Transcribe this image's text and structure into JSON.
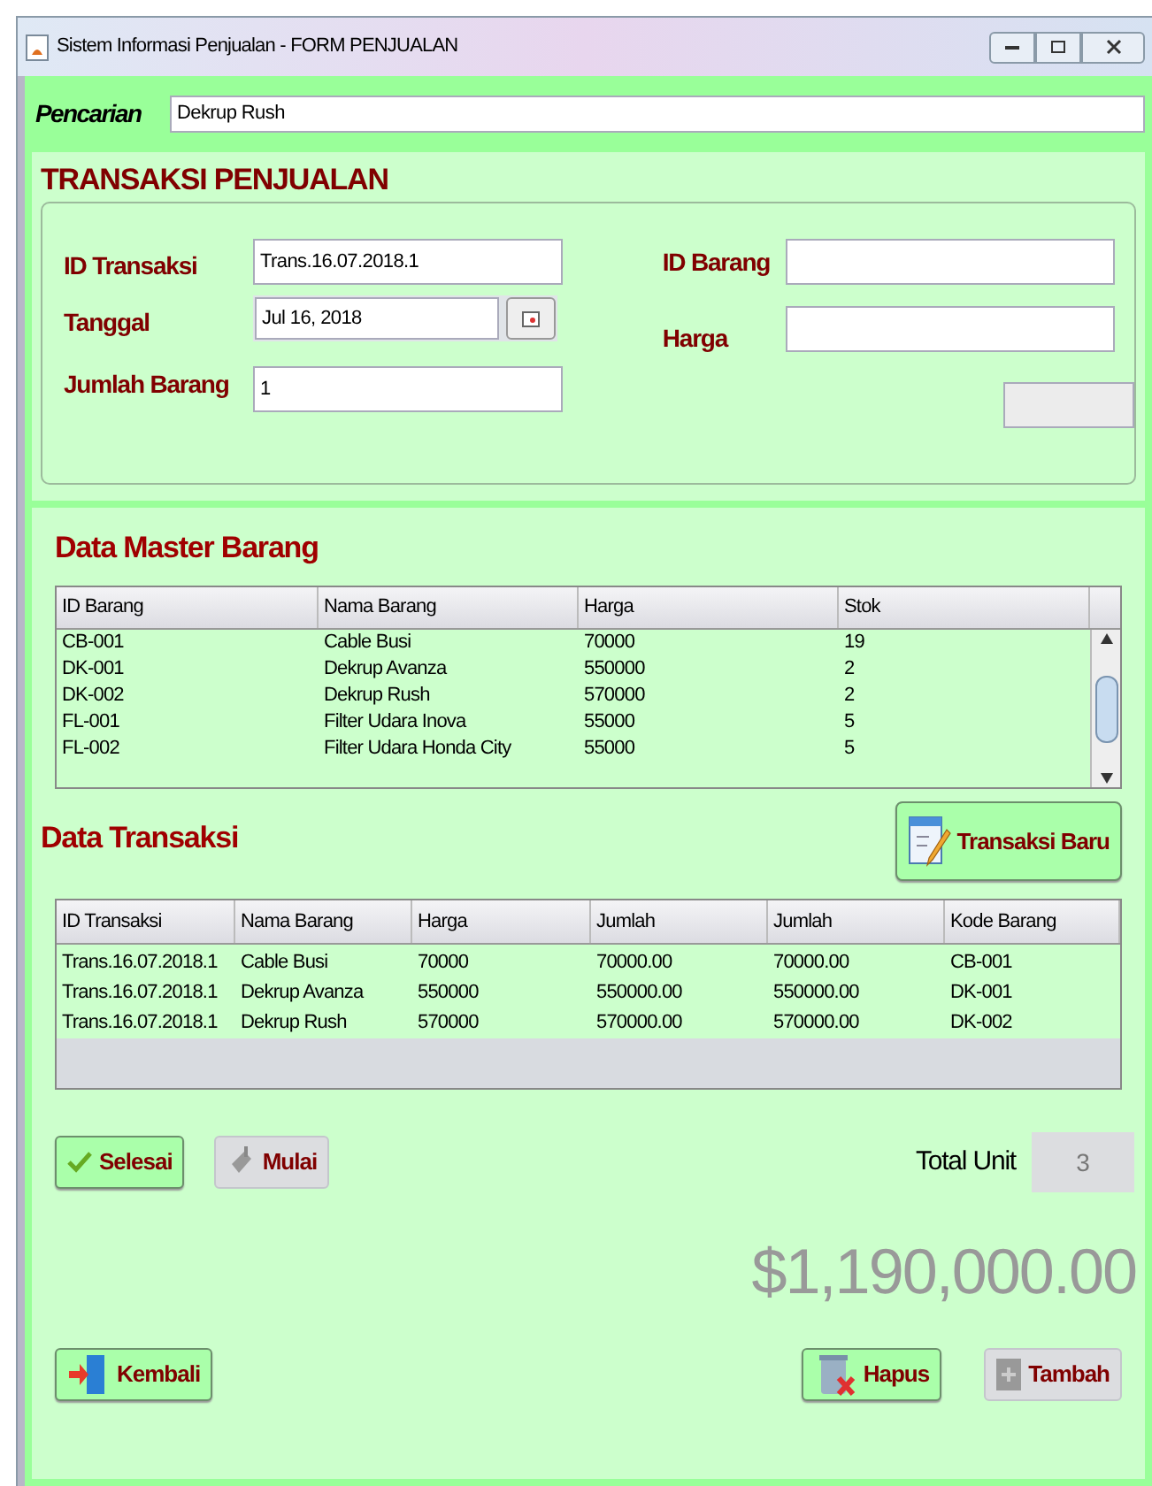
{
  "window": {
    "title": "Sistem Informasi Penjualan - FORM PENJUALAN"
  },
  "search": {
    "label": "Pencarian",
    "value": "Dekrup Rush"
  },
  "transaction_form": {
    "title": "TRANSAKSI PENJUALAN",
    "left_fields": [
      {
        "label": "ID Transaksi",
        "value": "Trans.16.07.2018.1",
        "kind": "text"
      },
      {
        "label": "Tanggal",
        "value": "Jul 16, 2018",
        "kind": "date"
      },
      {
        "label": "Jumlah Barang",
        "value": "1",
        "kind": "text"
      }
    ],
    "right_fields": [
      {
        "label": "ID Barang",
        "disabled": false
      },
      {
        "label": "Harga",
        "disabled": false
      },
      {
        "disabled": true
      }
    ]
  },
  "master_table": {
    "title": "Data Master Barang",
    "columns": [
      "ID Barang",
      "Nama Barang",
      "Harga",
      "Stok"
    ],
    "rows": [
      [
        "CB-001",
        "Cable Busi",
        "70000",
        "19"
      ],
      [
        "DK-001",
        "Dekrup Avanza",
        "550000",
        "2"
      ],
      [
        "DK-002",
        "Dekrup Rush",
        "570000",
        "2"
      ],
      [
        "FL-001",
        "Filter Udara Inova",
        "55000",
        "5"
      ],
      [
        "FL-002",
        "Filter Udara Honda City",
        "55000",
        "5"
      ]
    ]
  },
  "transaction_table": {
    "title": "Data Transaksi",
    "new_button": "Transaksi Baru",
    "columns": [
      "ID Transaksi",
      "Nama Barang",
      "Harga",
      "Jumlah",
      "Jumlah",
      "Kode Barang"
    ],
    "rows": [
      [
        "Trans.16.07.2018.1",
        "Cable Busi",
        "70000",
        "70000.00",
        "70000.00",
        "CB-001"
      ],
      [
        "Trans.16.07.2018.1",
        "Dekrup Avanza",
        "550000",
        "550000.00",
        "550000.00",
        "DK-001"
      ],
      [
        "Trans.16.07.2018.1",
        "Dekrup Rush",
        "570000",
        "570000.00",
        "570000.00",
        "DK-002"
      ]
    ]
  },
  "actions": [
    {
      "label": "Selesai",
      "kind": "check",
      "disabled": false
    },
    {
      "label": "Mulai",
      "kind": "eraser",
      "disabled": true
    }
  ],
  "total_unit": {
    "label": "Total Unit",
    "value": "3"
  },
  "total_amount": "$1,190,000.00",
  "bottom_buttons": [
    {
      "label": "Kembali",
      "kind": "exit",
      "disabled": false
    },
    {
      "label": "Hapus",
      "kind": "trash",
      "disabled": false
    },
    {
      "label": "Tambah",
      "kind": "plus",
      "disabled": true
    }
  ]
}
